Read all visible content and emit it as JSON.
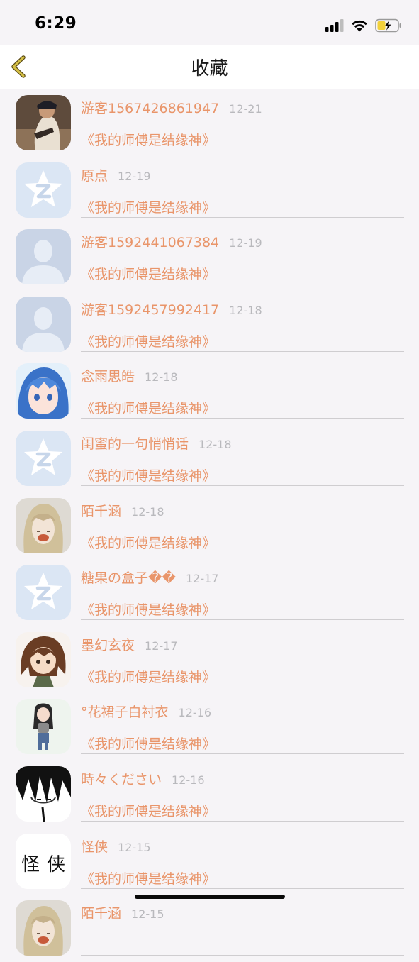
{
  "status_bar": {
    "time": "6:29"
  },
  "nav": {
    "title": "收藏",
    "back_icon": "chevron-left-icon"
  },
  "colors": {
    "accent": "#e9956a",
    "date": "#b9b9bd",
    "back": "#c9b23a"
  },
  "favorites": [
    {
      "name": "游客1567426861947",
      "date": "12-21",
      "book": "《我的师傅是结缘神》",
      "avatar": "photo"
    },
    {
      "name": "原点",
      "date": "12-19",
      "book": "《我的师傅是结缘神》",
      "avatar": "qq-default"
    },
    {
      "name": "游客1592441067384",
      "date": "12-19",
      "book": "《我的师傅是结缘神》",
      "avatar": "person-placeholder"
    },
    {
      "name": "游客1592457992417",
      "date": "12-18",
      "book": "《我的师傅是结缘神》",
      "avatar": "person-placeholder"
    },
    {
      "name": "念雨思皓",
      "date": "12-18",
      "book": "《我的师傅是结缘神》",
      "avatar": "anime-blue-hair"
    },
    {
      "name": "闺蜜的一句悄悄话",
      "date": "12-18",
      "book": "《我的师傅是结缘神》",
      "avatar": "qq-default"
    },
    {
      "name": "陌千涵",
      "date": "12-18",
      "book": "《我的师傅是结缘神》",
      "avatar": "girl-photo"
    },
    {
      "name": "糖果の盒子��",
      "date": "12-17",
      "book": "《我的师傅是结缘神》",
      "avatar": "qq-default"
    },
    {
      "name": "墨幻玄夜",
      "date": "12-17",
      "book": "《我的师傅是结缘神》",
      "avatar": "chibi-character"
    },
    {
      "name": "°花裙子白衬衣",
      "date": "12-16",
      "book": "《我的师傅是结缘神》",
      "avatar": "cartoon-girl"
    },
    {
      "name": "時々ください",
      "date": "12-16",
      "book": "《我的师傅是结缘神》",
      "avatar": "bw-sketch"
    },
    {
      "name": "怪侠",
      "date": "12-15",
      "book": "《我的师傅是结缘神》",
      "avatar": "calligraphy"
    },
    {
      "name": "陌千涵",
      "date": "12-15",
      "book": "",
      "avatar": "girl-photo"
    }
  ]
}
